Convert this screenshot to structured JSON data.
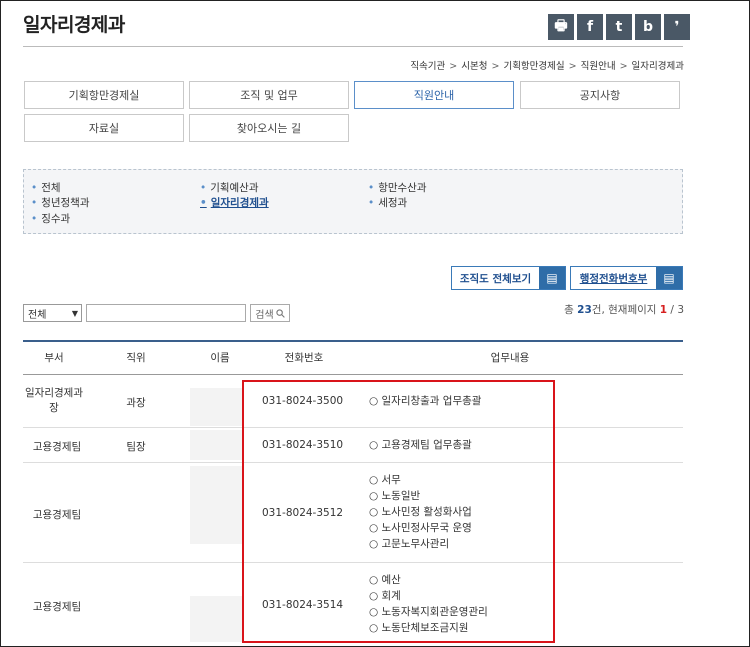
{
  "header": {
    "title": "일자리경제과",
    "share_icons": [
      {
        "name": "print-icon",
        "glyph": "🖶"
      },
      {
        "name": "facebook-icon",
        "glyph": "f"
      },
      {
        "name": "twitter-icon",
        "glyph": "t"
      },
      {
        "name": "blog-icon",
        "glyph": "b"
      },
      {
        "name": "story-icon",
        "glyph": "❜"
      }
    ]
  },
  "breadcrumb": [
    "직속기관",
    "시본청",
    "기획항만경제실",
    "직원안내",
    "일자리경제과"
  ],
  "tabs": [
    {
      "label": "기획항만경제실",
      "active": false
    },
    {
      "label": "조직 및 업무",
      "active": false
    },
    {
      "label": "직원안내",
      "active": true
    },
    {
      "label": "공지사항",
      "active": false
    },
    {
      "label": "자료실",
      "active": false
    },
    {
      "label": "찾아오시는 길",
      "active": false
    }
  ],
  "departments": [
    {
      "label": "전체",
      "current": false
    },
    {
      "label": "기획예산과",
      "current": false
    },
    {
      "label": "항만수산과",
      "current": false
    },
    {
      "label": "청년정책과",
      "current": false
    },
    {
      "label": "일자리경제과",
      "current": true
    },
    {
      "label": "세정과",
      "current": false
    },
    {
      "label": "징수과",
      "current": false
    }
  ],
  "actions": {
    "org_chart": "조직도 전체보기",
    "phonebook": "행정전화번호부",
    "doc_icon": "▤"
  },
  "search": {
    "select_value": "전체",
    "input_value": "",
    "button": "검색"
  },
  "count": {
    "prefix": "총 ",
    "total": "23",
    "mid": "건, 현재페이지 ",
    "current": "1",
    "sep": " / ",
    "pages": "3"
  },
  "table": {
    "headers": [
      "부서",
      "직위",
      "이름",
      "전화번호",
      "업무내용"
    ],
    "rows": [
      {
        "dept": "일자리경제과장",
        "position": "과장",
        "name": "",
        "phone": "031-8024-3500",
        "duties": [
          "○ 일자리창출과 업무총괄"
        ]
      },
      {
        "dept": "고용경제팀",
        "position": "팀장",
        "name": "",
        "phone": "031-8024-3510",
        "duties": [
          "○ 고용경제팀 업무총괄"
        ]
      },
      {
        "dept": "고용경제팀",
        "position": "",
        "name": "",
        "phone": "031-8024-3512",
        "duties": [
          "○ 서무",
          "○ 노동일반",
          "○ 노사민정 활성화사업",
          "○ 노사민정사무국 운영",
          "○ 고문노무사관리"
        ]
      },
      {
        "dept": "고용경제팀",
        "position": "",
        "name": "",
        "phone": "031-8024-3514",
        "duties": [
          "○ 예산",
          "○ 회계",
          "○ 노동자복지회관운영관리",
          "○ 노동단체보조금지원"
        ]
      }
    ]
  },
  "colors": {
    "accent": "#1f4f8f",
    "highlight": "#d9141a",
    "share_bg": "#4a5866"
  }
}
